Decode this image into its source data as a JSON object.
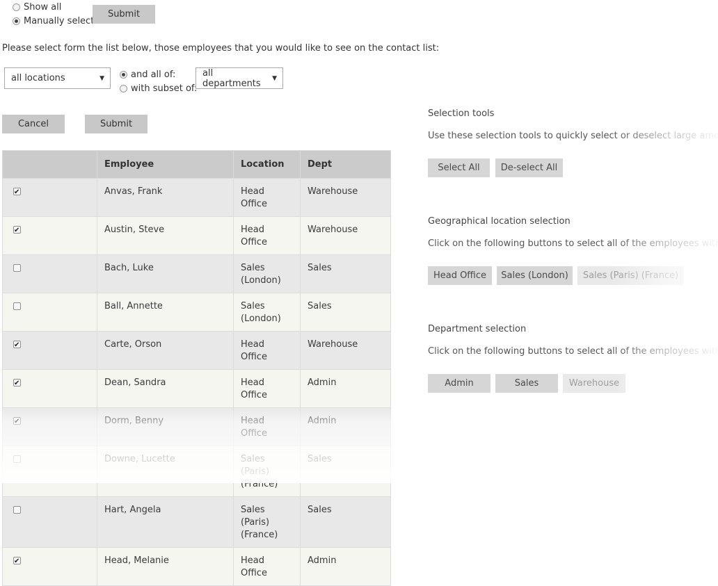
{
  "mode": {
    "show_all_label": "Show all",
    "manual_label": "Manually select",
    "submit_label": "Submit"
  },
  "instruction": "Please select form the list below, those employees that you would like to see on the contact list:",
  "filters": {
    "location_value": "all locations",
    "and_all_label": "and all of:",
    "subset_label": "with subset of:",
    "department_value": "all departments"
  },
  "actions": {
    "cancel_label": "Cancel",
    "submit_label": "Submit"
  },
  "table": {
    "headers": [
      "",
      "Employee",
      "Location",
      "Dept"
    ],
    "rows": [
      {
        "checked": true,
        "employee": "Anvas, Frank",
        "location": "Head Office",
        "dept": "Warehouse"
      },
      {
        "checked": true,
        "employee": "Austin, Steve",
        "location": "Head Office",
        "dept": "Warehouse"
      },
      {
        "checked": false,
        "employee": "Bach, Luke",
        "location": "Sales (London)",
        "dept": "Sales"
      },
      {
        "checked": false,
        "employee": "Ball, Annette",
        "location": "Sales (London)",
        "dept": "Sales"
      },
      {
        "checked": true,
        "employee": "Carte, Orson",
        "location": "Head Office",
        "dept": "Warehouse"
      },
      {
        "checked": true,
        "employee": "Dean, Sandra",
        "location": "Head Office",
        "dept": "Admin"
      },
      {
        "checked": true,
        "employee": "Dorm, Benny",
        "location": "Head Office",
        "dept": "Admin"
      },
      {
        "checked": false,
        "employee": "Downe, Lucette",
        "location": "Sales (Paris) (France)",
        "dept": "Sales"
      },
      {
        "checked": false,
        "employee": "Hart, Angela",
        "location": "Sales (Paris) (France)",
        "dept": "Sales"
      },
      {
        "checked": true,
        "employee": "Head, Melanie",
        "location": "Head Office",
        "dept": "Admin"
      }
    ]
  },
  "selection_tools": {
    "title": "Selection tools",
    "desc": "Use these selection tools to quickly select or deselect large amounts of",
    "select_all_label": "Select All",
    "deselect_all_label": "De-select All"
  },
  "geo": {
    "title": "Geographical location selection",
    "desc": "Click on the following buttons to select all of the employees within the",
    "buttons": [
      "Head Office",
      "Sales (London)",
      "Sales (Paris) (France)"
    ]
  },
  "dept": {
    "title": "Department selection",
    "desc": "Click on the following buttons to select all of the employees within that",
    "buttons": [
      "Admin",
      "Sales",
      "Warehouse"
    ]
  }
}
